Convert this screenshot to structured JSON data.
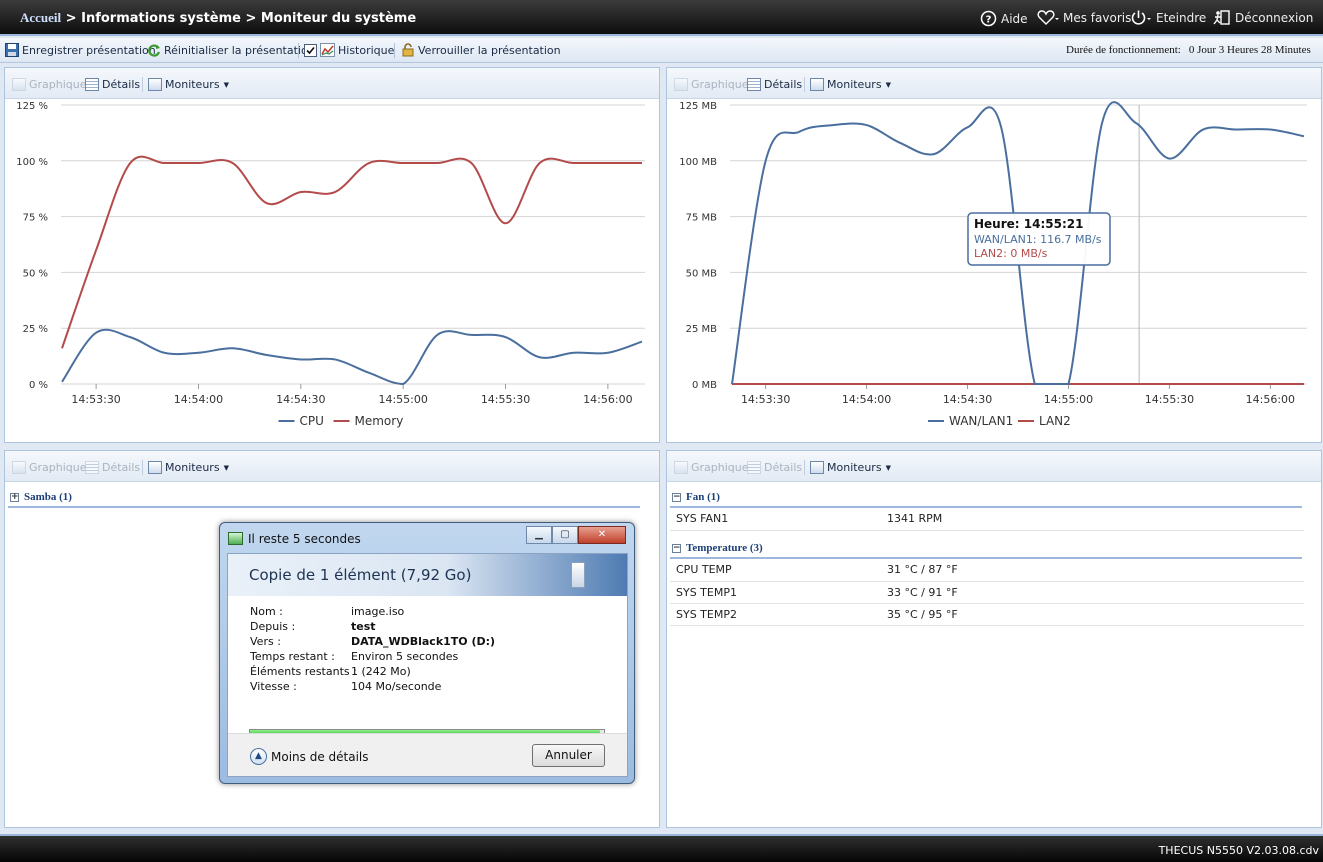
{
  "topbar": {
    "crumb_home": "Accueil",
    "crumb_rest": " > Informations système > Moniteur du système",
    "help": "Aide",
    "favorites": "Mes favoris",
    "shutdown": "Eteindre",
    "logout": "Déconnexion"
  },
  "toolbar": {
    "save": "Enregistrer présentation",
    "reset": "Réinitialiser la présentation",
    "history": "Historique",
    "history_checked": true,
    "lock": "Verrouiller la présentation",
    "uptime_label": "Durée de fonctionnement:",
    "uptime_value": "0 Jour 3 Heures 28 Minutes"
  },
  "panel_tools": {
    "graph": "Graphique",
    "details": "Détails",
    "monitors": "Moniteurs"
  },
  "chart_data": [
    {
      "type": "line",
      "x": [
        "14:53:20",
        "14:53:30",
        "14:53:40",
        "14:53:50",
        "14:54:00",
        "14:54:10",
        "14:54:20",
        "14:54:30",
        "14:54:40",
        "14:54:50",
        "14:55:00",
        "14:55:10",
        "14:55:20",
        "14:55:30",
        "14:55:40",
        "14:55:50",
        "14:56:00",
        "14:56:10"
      ],
      "x_ticks": [
        "14:53:30",
        "14:54:00",
        "14:54:30",
        "14:55:00",
        "14:55:30",
        "14:56:00"
      ],
      "y_ticks": [
        "0 %",
        "25 %",
        "50 %",
        "75 %",
        "100 %",
        "125 %"
      ],
      "ylim": [
        0,
        125
      ],
      "grid": true,
      "legend": "bottom",
      "series": [
        {
          "name": "CPU",
          "color": "#4a6f9e",
          "values": [
            1,
            23,
            21,
            14,
            14,
            16,
            13,
            11,
            11,
            5,
            0,
            22,
            22,
            21,
            12,
            14,
            14,
            19
          ]
        },
        {
          "name": "Memory",
          "color": "#b44b4b",
          "values": [
            16,
            60,
            99,
            99,
            99,
            99,
            81,
            86,
            86,
            99,
            99,
            99,
            99,
            72,
            99,
            99,
            99,
            99
          ]
        }
      ]
    },
    {
      "type": "line",
      "x": [
        "14:53:20",
        "14:53:30",
        "14:53:40",
        "14:53:50",
        "14:54:00",
        "14:54:10",
        "14:54:20",
        "14:54:30",
        "14:54:40",
        "14:54:50",
        "14:55:00",
        "14:55:10",
        "14:55:20",
        "14:55:30",
        "14:55:40",
        "14:55:50",
        "14:56:00",
        "14:56:10"
      ],
      "x_ticks": [
        "14:53:30",
        "14:54:00",
        "14:54:30",
        "14:55:00",
        "14:55:30",
        "14:56:00"
      ],
      "y_ticks": [
        "0 MB",
        "25 MB",
        "50 MB",
        "75 MB",
        "100 MB",
        "125 MB"
      ],
      "ylim": [
        0,
        125
      ],
      "grid": true,
      "legend": "bottom",
      "series": [
        {
          "name": "WAN/LAN1",
          "color": "#4a6f9e",
          "values": [
            0,
            100,
            113,
            116,
            116,
            108,
            103,
            115,
            115,
            0,
            0,
            117,
            117,
            101,
            114,
            114,
            114,
            111
          ]
        },
        {
          "name": "LAN2",
          "color": "#b44b4b",
          "values": [
            0,
            0,
            0,
            0,
            0,
            0,
            0,
            0,
            0,
            0,
            0,
            0,
            0,
            0,
            0,
            0,
            0,
            0
          ]
        }
      ],
      "tooltip": {
        "title": "Heure: 14:55:21",
        "line1": "WAN/LAN1: 116.7 MB/s",
        "line2": "LAN2: 0 MB/s",
        "crosshair_x": "14:55:21"
      }
    }
  ],
  "samba": {
    "title": "Samba (1)"
  },
  "sensors": {
    "fan_title": "Fan (1)",
    "fans": [
      {
        "name": "SYS FAN1",
        "value": "1341 RPM"
      }
    ],
    "temp_title": "Temperature (3)",
    "temps": [
      {
        "name": "CPU TEMP",
        "value": "31 °C / 87 °F"
      },
      {
        "name": "SYS TEMP1",
        "value": "33 °C / 91 °F"
      },
      {
        "name": "SYS TEMP2",
        "value": "35 °C / 95 °F"
      }
    ]
  },
  "dialog": {
    "title": "Il reste 5 secondes",
    "heading": "Copie de 1 élément (7,92 Go)",
    "rows": [
      {
        "label": "Nom :",
        "value": "image.iso",
        "bold": false
      },
      {
        "label": "Depuis :",
        "value": "test",
        "bold": true
      },
      {
        "label": "Vers :",
        "value": "DATA_WDBlack1TO (D:)",
        "bold": true
      },
      {
        "label": "Temps restant :",
        "value": "Environ 5 secondes",
        "bold": false
      },
      {
        "label": "Éléments restants :",
        "value": "1 (242 Mo)",
        "bold": false
      },
      {
        "label": "Vitesse :",
        "value": "104 Mo/seconde",
        "bold": false
      }
    ],
    "progress": 0.99,
    "less_details": "Moins de détails",
    "cancel": "Annuler"
  },
  "footer": {
    "version": "THECUS N5550 V2.03.08.cdv"
  }
}
